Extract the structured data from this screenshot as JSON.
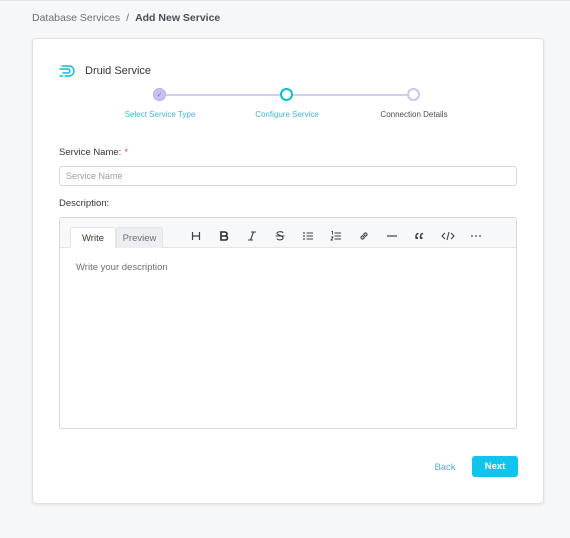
{
  "breadcrumb": {
    "parent": "Database Services",
    "separator": "/",
    "current": "Add New Service"
  },
  "header": {
    "title": "Druid Service",
    "icon": "druid-logo-icon"
  },
  "stepper": {
    "steps": [
      {
        "label": "Select Service Type",
        "state": "done"
      },
      {
        "label": "Configure Service",
        "state": "active"
      },
      {
        "label": "Connection Details",
        "state": "pending"
      }
    ],
    "done_mark": "✓"
  },
  "form": {
    "service_name_label": "Service Name:",
    "required_mark": "*",
    "service_name_placeholder": "Service Name",
    "service_name_value": "",
    "description_label": "Description:"
  },
  "editor": {
    "tabs": {
      "write": "Write",
      "preview": "Preview"
    },
    "active_tab": "Write",
    "toolbar_icons": [
      "heading-icon",
      "bold-icon",
      "italic-icon",
      "strikethrough-icon",
      "bullet-list-icon",
      "numbered-list-icon",
      "link-icon",
      "horizontal-rule-icon",
      "quote-icon",
      "code-icon",
      "more-icon"
    ],
    "placeholder": "Write your description"
  },
  "actions": {
    "back": "Back",
    "next": "Next"
  },
  "colors": {
    "accent": "#11c4ec",
    "link": "#47b5d8",
    "step_done": "#c9c0ef",
    "required": "#e5484d"
  }
}
